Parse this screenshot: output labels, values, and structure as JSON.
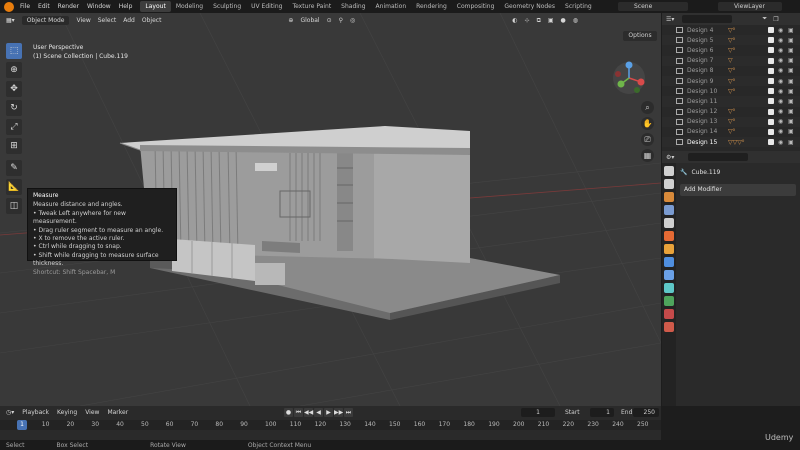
{
  "topbar": {
    "menus": [
      "File",
      "Edit",
      "Render",
      "Window",
      "Help"
    ],
    "workspaces": [
      "Layout",
      "Modeling",
      "Sculpting",
      "UV Editing",
      "Texture Paint",
      "Shading",
      "Animation",
      "Rendering",
      "Compositing",
      "Geometry Nodes",
      "Scripting"
    ],
    "active_workspace": "Layout",
    "scene": "Scene",
    "view_layer": "ViewLayer"
  },
  "viewport": {
    "mode": "Object Mode",
    "menus": [
      "View",
      "Select",
      "Add",
      "Object"
    ],
    "transform": "Global",
    "perspective": "User Perspective",
    "collection_info": "(1) Scene Collection | Cube.119",
    "options": "Options"
  },
  "tooltip": {
    "title": "Measure",
    "lines": [
      "Measure distance and angles.",
      "• Tweak Left anywhere for new measurement.",
      "• Drag ruler segment to measure an angle.",
      "• X to remove the active ruler.",
      "• Ctrl while dragging to snap.",
      "• Shift while dragging to measure surface thickness."
    ],
    "shortcut": "Shortcut: Shift Spacebar, M"
  },
  "outliner": {
    "items": [
      {
        "name": "Design 4",
        "mods": "▽⁰"
      },
      {
        "name": "Design 5",
        "mods": "▽⁰"
      },
      {
        "name": "Design 6",
        "mods": "▽⁰"
      },
      {
        "name": "Design 7",
        "mods": "▽"
      },
      {
        "name": "Design 8",
        "mods": "▽⁰"
      },
      {
        "name": "Design 9",
        "mods": "▽⁰"
      },
      {
        "name": "Design 10",
        "mods": "▽⁰"
      },
      {
        "name": "Design 11",
        "mods": ""
      },
      {
        "name": "Design 12",
        "mods": "▽⁰"
      },
      {
        "name": "Design 13",
        "mods": "▽⁰"
      },
      {
        "name": "Design 14",
        "mods": "▽⁰"
      },
      {
        "name": "Design 15",
        "mods": "▽▽▽⁰"
      }
    ]
  },
  "properties": {
    "object": "Cube.119",
    "add_modifier": "Add Modifier",
    "tab_colors": [
      "#cfcfcf",
      "#cfcfcf",
      "#d88a3a",
      "#7a9bd1",
      "#cfcfcf",
      "#e56a34",
      "#e8a23a",
      "#4f8fe0",
      "#6aa0e6",
      "#5ec8c8",
      "#4ea45c",
      "#c54a4a",
      "#cf5a4a"
    ]
  },
  "timeline": {
    "menus": [
      "Playback",
      "Keying",
      "View",
      "Marker"
    ],
    "current_frame": "1",
    "start_label": "Start",
    "start": "1",
    "end_label": "End",
    "end": "250",
    "ticks": [
      "1",
      "10",
      "20",
      "30",
      "40",
      "50",
      "60",
      "70",
      "80",
      "90",
      "100",
      "110",
      "120",
      "130",
      "140",
      "150",
      "160",
      "170",
      "180",
      "190",
      "200",
      "210",
      "220",
      "230",
      "240",
      "250"
    ]
  },
  "statusbar": {
    "items": [
      "Select",
      "Box Select",
      "Rotate View",
      "Object Context Menu"
    ]
  },
  "watermark": "Udemy"
}
